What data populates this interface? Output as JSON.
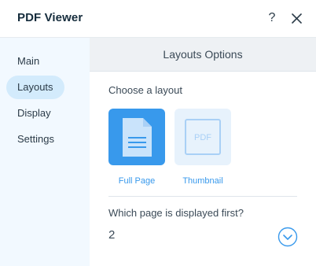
{
  "window": {
    "title": "PDF Viewer",
    "help_label": "?"
  },
  "sidebar": {
    "items": [
      {
        "label": "Main",
        "active": false
      },
      {
        "label": "Layouts",
        "active": true
      },
      {
        "label": "Display",
        "active": false
      },
      {
        "label": "Settings",
        "active": false
      }
    ]
  },
  "main": {
    "section_title": "Layouts Options",
    "choose_label": "Choose a layout",
    "layouts": [
      {
        "label": "Full Page",
        "icon": "document-icon",
        "selected": true
      },
      {
        "label": "Thumbnail",
        "icon": "pdf-thumbnail-icon",
        "selected": false,
        "icon_text": "PDF"
      }
    ],
    "first_page": {
      "label": "Which page is displayed first?",
      "value": "2"
    }
  },
  "colors": {
    "accent": "#3899ec",
    "sidebar_bg": "#f2f9ff",
    "sidebar_active": "#d3ebfc",
    "section_header_bg": "#eef1f4",
    "thumbnail_bg": "#e7f2fc"
  }
}
